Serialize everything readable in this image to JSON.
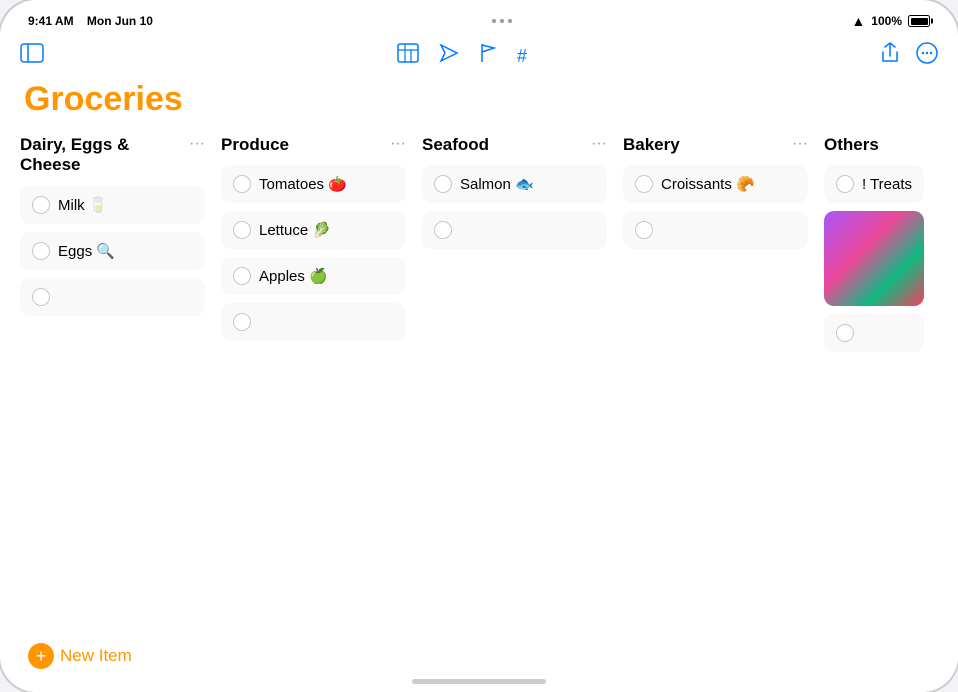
{
  "status": {
    "time": "9:41 AM",
    "date": "Mon Jun 10",
    "battery": "100%"
  },
  "toolbar": {
    "sidebar_icon": "⊞",
    "table_icon": "📋",
    "navigate_icon": "⟩",
    "flag_icon": "⚑",
    "hash_icon": "#",
    "share_icon": "↑",
    "more_icon": "•••"
  },
  "page": {
    "title": "Groceries"
  },
  "columns": [
    {
      "id": "dairy",
      "title": "Dairy, Eggs & Cheese",
      "items": [
        {
          "label": "Milk 🥛",
          "checked": false
        },
        {
          "label": "Eggs 🔍",
          "checked": false
        },
        {
          "label": "",
          "checked": false
        }
      ]
    },
    {
      "id": "produce",
      "title": "Produce",
      "items": [
        {
          "label": "Tomatoes 🍅",
          "checked": false
        },
        {
          "label": "Lettuce 🥬",
          "checked": false
        },
        {
          "label": "Apples 🍏",
          "checked": false
        },
        {
          "label": "",
          "checked": false
        }
      ]
    },
    {
      "id": "seafood",
      "title": "Seafood",
      "items": [
        {
          "label": "Salmon 🐟",
          "checked": false
        },
        {
          "label": "",
          "checked": false
        }
      ]
    },
    {
      "id": "bakery",
      "title": "Bakery",
      "items": [
        {
          "label": "Croissants 🥐",
          "checked": false
        },
        {
          "label": "",
          "checked": false
        }
      ]
    },
    {
      "id": "others",
      "title": "Others",
      "items": [
        {
          "label": "! Treats for",
          "checked": false
        },
        {
          "label": "",
          "checked": false
        }
      ]
    }
  ],
  "bottom": {
    "new_item_label": "New Item",
    "plus_symbol": "+"
  }
}
